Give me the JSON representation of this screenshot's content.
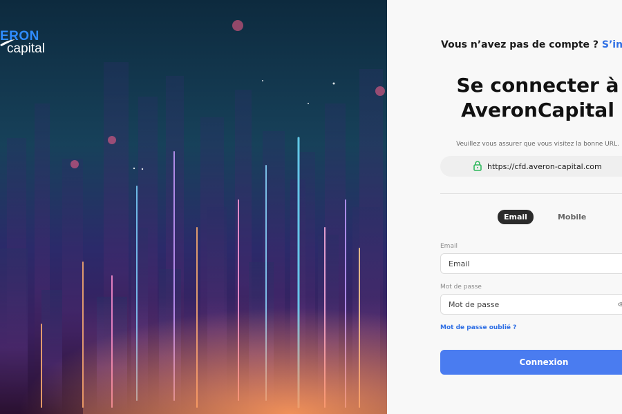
{
  "brand": {
    "logo_top": "ERON",
    "logo_bottom": "capital"
  },
  "header": {
    "signup_prompt": "Vous n’avez pas de compte ?",
    "signup_link": "S’inscr"
  },
  "main": {
    "title_line1": "Se connecter à",
    "title_line2": "AveronCapital",
    "verify_text": "Veuillez vous assurer que vous visitez la bonne URL.",
    "url": "https://cfd.averon-capital.com",
    "tabs": [
      {
        "label": "Email",
        "active": true
      },
      {
        "label": "Mobile",
        "active": false
      }
    ],
    "email": {
      "label": "Email",
      "placeholder": "Email",
      "value": ""
    },
    "password": {
      "label": "Mot de passe",
      "placeholder": "Mot de passe",
      "value": ""
    },
    "forgot_label": "Mot de passe oublié ?",
    "submit_label": "Connexion"
  },
  "colors": {
    "accent": "#4a7cf0",
    "link": "#2f6fe4",
    "lock_icon": "#2eb85c",
    "active_tab_bg": "#2b2b2b"
  },
  "icons": [
    "lock-icon",
    "eye-icon",
    "logo-swoosh-icon"
  ]
}
